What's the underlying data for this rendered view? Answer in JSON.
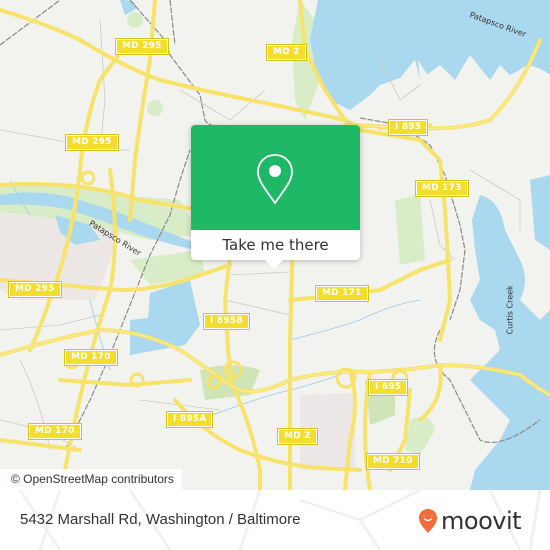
{
  "map": {
    "attribution": "© OpenStreetMap contributors",
    "road_shields": [
      {
        "label": "MD 295"
      },
      {
        "label": "MD 2"
      },
      {
        "label": "MD 295"
      },
      {
        "label": "I 895"
      },
      {
        "label": "MD 173"
      },
      {
        "label": "MD 295"
      },
      {
        "label": "MD 171"
      },
      {
        "label": "I 895B"
      },
      {
        "label": "MD 170"
      },
      {
        "label": "I 695"
      },
      {
        "label": "I 895A"
      },
      {
        "label": "MD 170"
      },
      {
        "label": "MD 2"
      },
      {
        "label": "MD 710"
      }
    ],
    "water_labels": [
      {
        "label": "Patapsco River"
      },
      {
        "label": "Patapsco River"
      },
      {
        "label": "Curtis Creek"
      }
    ],
    "colors": {
      "land": "#f2f2ee",
      "water": "#aad8ee",
      "park": "#d6ebc4",
      "road_major": "#f7e36a",
      "shield": "#f4de2a"
    }
  },
  "popup": {
    "icon": "location-pin-icon",
    "cta_label": "Take me there",
    "accent_color": "#1fb866"
  },
  "footer": {
    "address": "5432 Marshall Rd, Washington / Baltimore",
    "brand": "moovit",
    "brand_color": "#f26b3a"
  }
}
